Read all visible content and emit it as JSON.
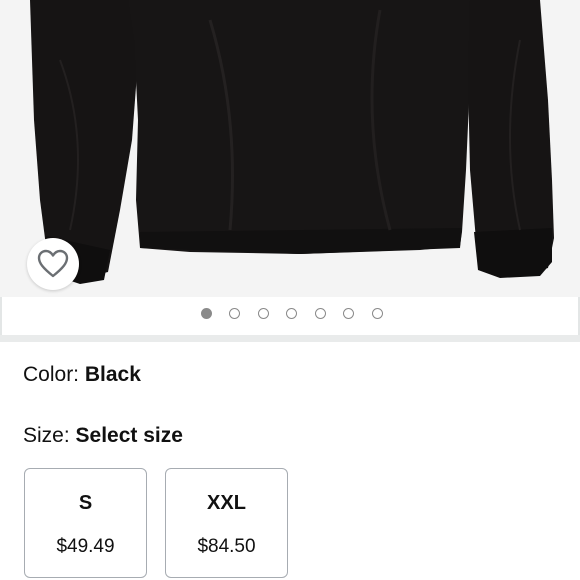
{
  "product_image": {
    "description_icon": "black-long-sleeve-shirt-image",
    "carousel": {
      "total": 7,
      "active_index": 0
    },
    "wishlist_icon": "heart-outline-icon"
  },
  "color": {
    "label": "Color: ",
    "value": "Black"
  },
  "size": {
    "label": "Size: ",
    "value": "Select size",
    "options": [
      {
        "label": "S",
        "price": "$49.49"
      },
      {
        "label": "XXL",
        "price": "$84.50"
      }
    ]
  },
  "colors": {
    "background": "#ffffff",
    "image_bg": "#f4f4f4",
    "shirt": "#141212",
    "card_border": "#a7acb2",
    "dot": "#8a8a8a",
    "divider": "#e9ebeb"
  }
}
